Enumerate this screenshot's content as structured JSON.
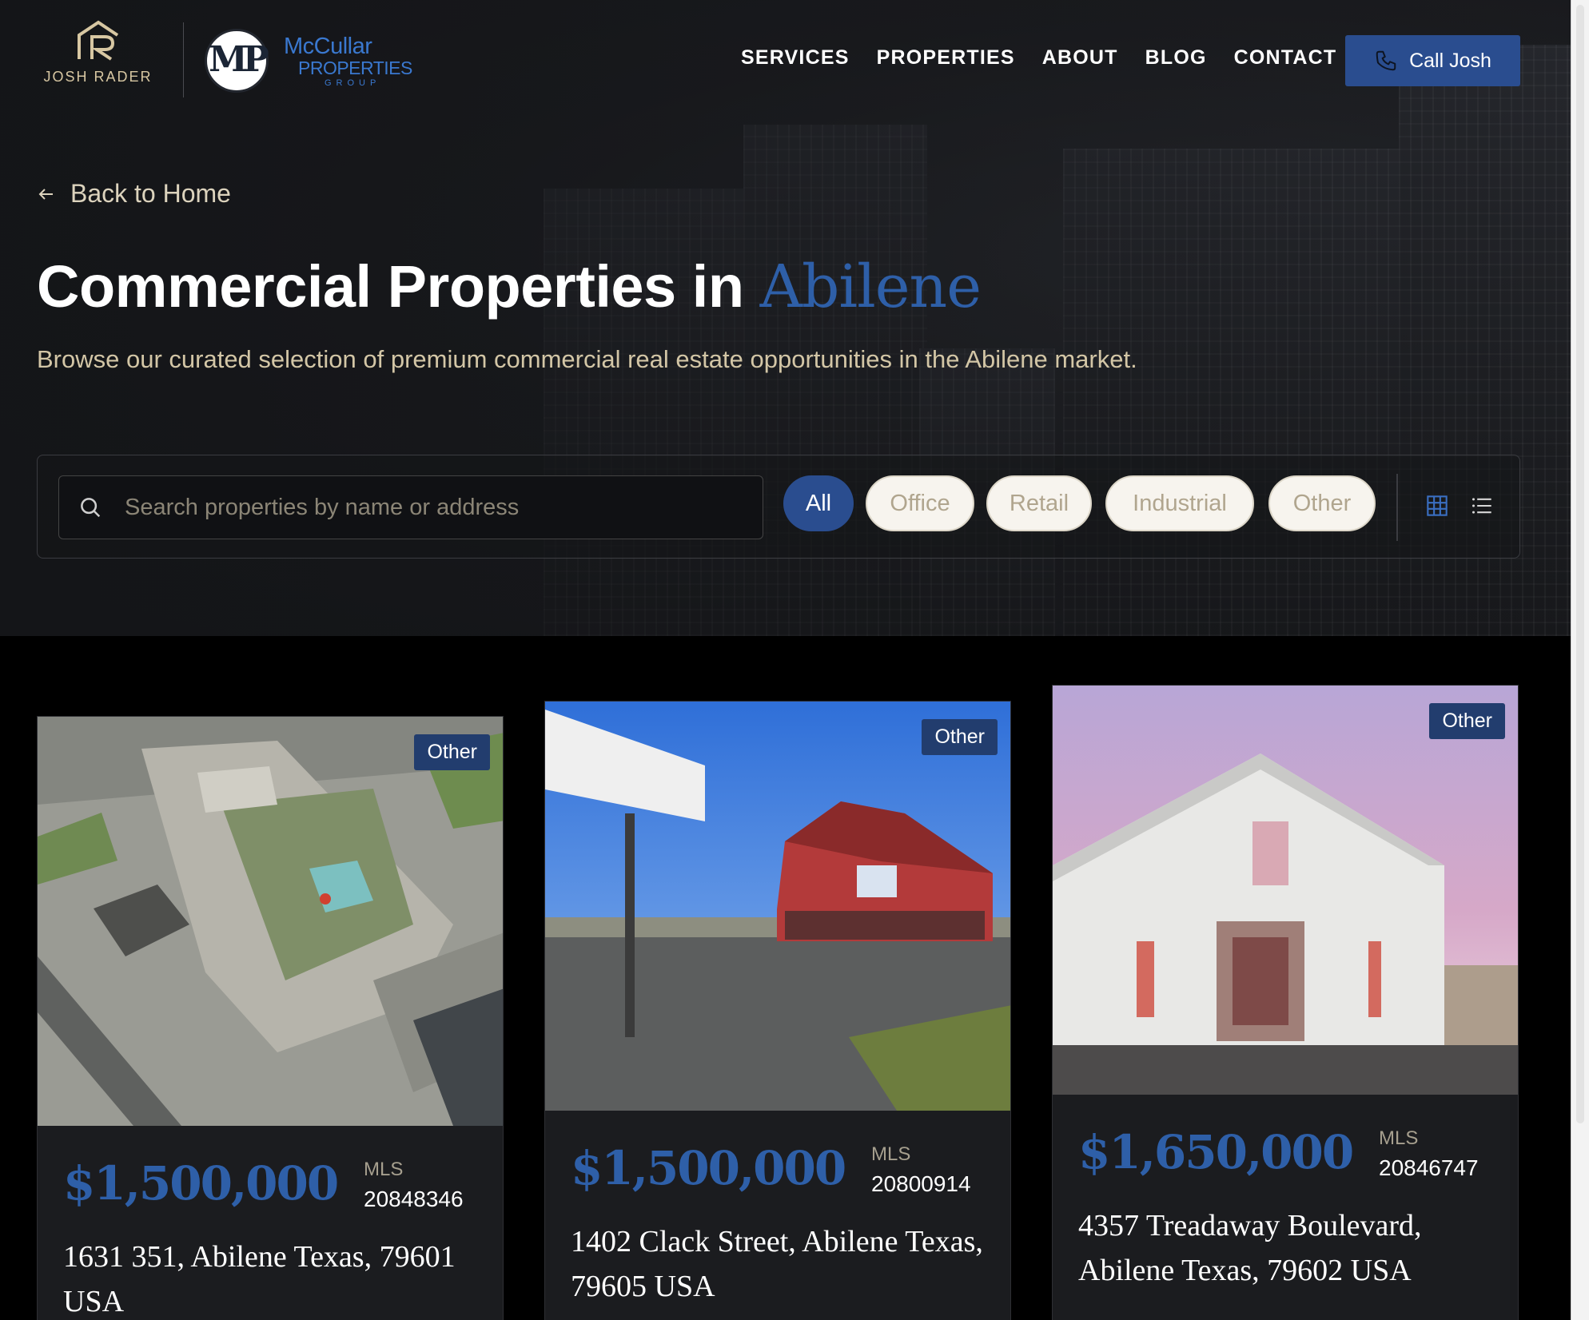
{
  "brand": {
    "josh_rader": "JOSH RADER",
    "mp_monogram": "MP",
    "mccullar_line1": "McCullar",
    "mccullar_line2": "PROPERTIES",
    "mccullar_line3": "GROUP"
  },
  "nav": {
    "links": [
      "SERVICES",
      "PROPERTIES",
      "ABOUT",
      "BLOG",
      "CONTACT"
    ],
    "call_button": "Call Josh"
  },
  "hero": {
    "back_link": "Back to Home",
    "title_prefix": "Commercial Properties in ",
    "title_accent": "Abilene",
    "subtitle": "Browse our curated selection of premium commercial real estate opportunities in the Abilene market."
  },
  "filters": {
    "search_placeholder": "Search properties by name or address",
    "chips": [
      "All",
      "Office",
      "Retail",
      "Industrial",
      "Other"
    ],
    "active_chip": "All",
    "view_modes": [
      "grid-view-icon",
      "list-view-icon"
    ]
  },
  "listings": [
    {
      "tag": "Other",
      "price": "$1,500,000",
      "mls_label": "MLS",
      "mls": "20848346",
      "address": "1631 351, Abilene Texas, 79601 USA"
    },
    {
      "tag": "Other",
      "price": "$1,500,000",
      "mls_label": "MLS",
      "mls": "20800914",
      "address": "1402 Clack Street, Abilene Texas, 79605 USA"
    },
    {
      "tag": "Other",
      "price": "$1,650,000",
      "mls_label": "MLS",
      "mls": "20846747",
      "address": "4357 Treadaway Boulevard, Abilene Texas, 79602 USA"
    }
  ],
  "colors": {
    "accent_blue": "#2a4d8f",
    "title_accent": "#2e5fa8",
    "gold_text": "#d3c6a6",
    "background": "#000000"
  }
}
